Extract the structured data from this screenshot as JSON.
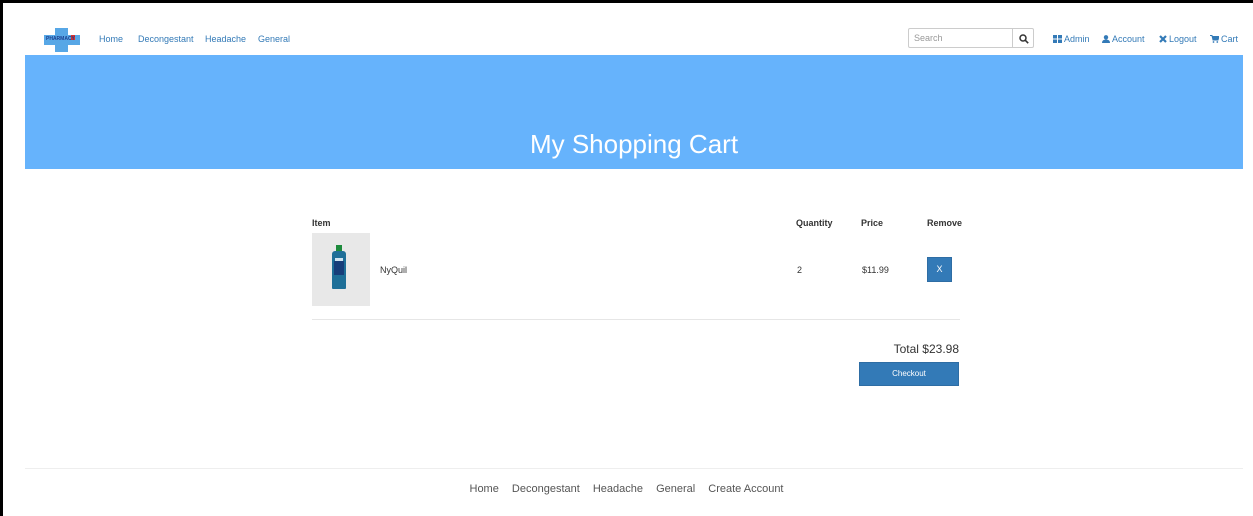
{
  "nav": {
    "logo_text": "PHARMACY",
    "links": [
      "Home",
      "Decongestant",
      "Headache",
      "General"
    ],
    "search_placeholder": "Search",
    "admin": "Admin",
    "account": "Account",
    "logout": "Logout",
    "cart": "Cart"
  },
  "banner": {
    "title": "My Shopping Cart"
  },
  "cart": {
    "headers": {
      "item": "Item",
      "quantity": "Quantity",
      "price": "Price",
      "remove": "Remove"
    },
    "rows": [
      {
        "name": "NyQuil",
        "quantity": "2",
        "price": "$11.99",
        "remove_label": "X"
      }
    ],
    "total": "Total $23.98",
    "checkout_label": "Checkout"
  },
  "footer": {
    "links": [
      "Home",
      "Decongestant",
      "Headache",
      "General",
      "Create Account"
    ]
  },
  "colors": {
    "accent": "#337ab7",
    "banner": "#66b3fc"
  }
}
